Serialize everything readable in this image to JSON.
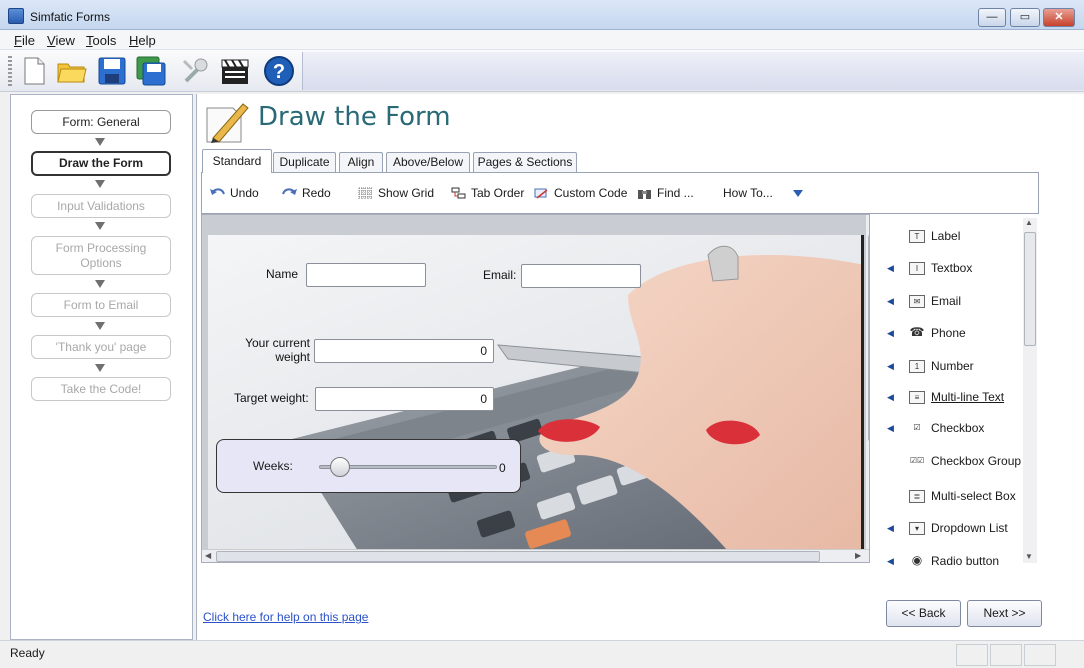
{
  "window": {
    "title": "Simfatic Forms",
    "minimize": "—",
    "maximize": "▭",
    "close": "✕"
  },
  "menu": {
    "items": [
      "File",
      "View",
      "Tools",
      "Help"
    ]
  },
  "toolbar": {
    "buttons": [
      "new-file-icon",
      "open-folder-icon",
      "save-icon",
      "save-all-icon",
      "settings-wrench-icon",
      "clapperboard-icon",
      "help-icon"
    ]
  },
  "wizard": {
    "steps": [
      {
        "label": "Form: General",
        "state": "normal"
      },
      {
        "label": "Draw the Form",
        "state": "active"
      },
      {
        "label": "Input Validations",
        "state": "disabled"
      },
      {
        "label": "Form Processing Options",
        "state": "disabled"
      },
      {
        "label": "Form to Email",
        "state": "disabled"
      },
      {
        "label": "'Thank you' page",
        "state": "disabled"
      },
      {
        "label": "Take the Code!",
        "state": "disabled"
      }
    ]
  },
  "main": {
    "heading": "Draw the Form",
    "tabs": [
      "Standard",
      "Duplicate",
      "Align",
      "Above/Below",
      "Pages & Sections"
    ],
    "active_tab": "Standard",
    "commands": [
      "Undo",
      "Redo",
      "Show Grid",
      "Tab Order",
      "Custom Code",
      "Find ...",
      "How To..."
    ]
  },
  "form": {
    "name_label": "Name",
    "email_label": "Email:",
    "weight_label": "Your current weight",
    "weight_value": "0",
    "target_label": "Target weight:",
    "target_value": "0",
    "weeks_label": "Weeks:",
    "weeks_value": "0",
    "weeks_slider_level": 0.07
  },
  "palette": {
    "items": [
      {
        "label": "Label",
        "icon": "label-icon",
        "expandable": false
      },
      {
        "label": "Textbox",
        "icon": "textbox-icon",
        "expandable": true
      },
      {
        "label": "Email",
        "icon": "email-icon",
        "expandable": true
      },
      {
        "label": "Phone",
        "icon": "phone-icon",
        "expandable": true
      },
      {
        "label": "Number",
        "icon": "number-icon",
        "expandable": true
      },
      {
        "label": "Multi-line Text",
        "icon": "multiline-text-icon",
        "expandable": true
      },
      {
        "label": "Checkbox",
        "icon": "checkbox-icon",
        "expandable": true
      },
      {
        "label": "Checkbox Group",
        "icon": "checkbox-group-icon",
        "expandable": false
      },
      {
        "label": "Multi-select Box",
        "icon": "multiselect-box-icon",
        "expandable": false
      },
      {
        "label": "Dropdown List",
        "icon": "dropdown-list-icon",
        "expandable": true
      },
      {
        "label": "Radio button",
        "icon": "radio-button-icon",
        "expandable": true
      }
    ]
  },
  "footer": {
    "help_link": "Click here for help on this page",
    "back_button": "<< Back",
    "next_button": "Next >>"
  },
  "status": {
    "text": "Ready"
  }
}
